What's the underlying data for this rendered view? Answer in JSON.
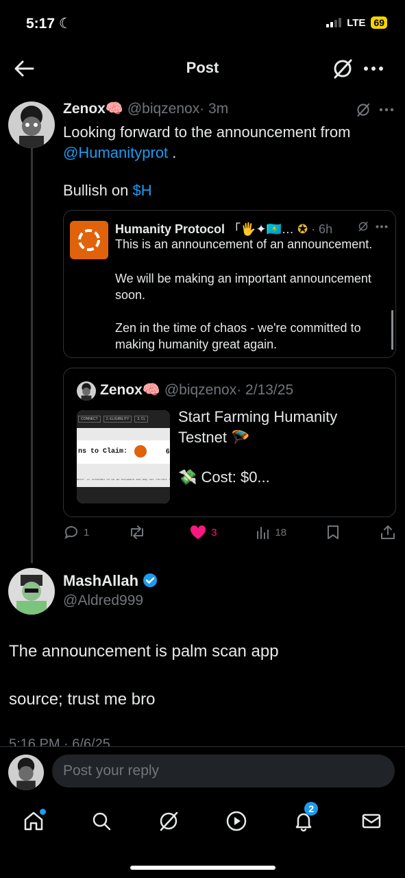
{
  "status": {
    "time": "5:17",
    "network": "LTE",
    "battery": "69"
  },
  "header": {
    "title": "Post"
  },
  "tweet": {
    "name": "Zenox🧠",
    "handle": "@biqzenox",
    "time": "· 3m",
    "text_line1": "Looking forward to the announcement from",
    "mention": "@Humanityprot",
    "after_mention": " .",
    "bullish": "Bullish on ",
    "cashtag": "$H",
    "quote": {
      "name": "Humanity Protocol",
      "emojis": "「🖐✦🇰🇿…",
      "time": "· 6h",
      "line1": "This is an announcement of an announcement.",
      "para2": "We will be making an important announcement soon.",
      "para3": "Zen in the time of chaos - we're committed to making humanity great again."
    },
    "quote2": {
      "name": "Zenox🧠",
      "handle": "@biqzenox",
      "date": "· 2/13/25",
      "text1": "Start Farming  Humanity Testnet 🪂",
      "text2": "💸 Cost: $0...",
      "thumb_tabs": [
        "CONNECT",
        "2. ELIGIBILITY",
        "3. CL"
      ],
      "thumb_label": "ns to Claim:",
      "thumb_value": "6",
      "thumb_note": "Note: It intended to be an estimate and may not reflect final data"
    },
    "counts": {
      "replies": "1",
      "reposts": "",
      "likes": "3",
      "views": "18"
    }
  },
  "reply": {
    "name": "MashAllah",
    "handle": "@Aldred999",
    "text1": "The announcement is palm scan app",
    "text2": "source; trust me bro",
    "timestamp": "5:16 PM · 6/6/25"
  },
  "composer": {
    "placeholder": "Post your reply"
  },
  "tabbar": {
    "notif_badge": "2"
  },
  "colors": {
    "like": "#f91880",
    "link": "#1d9bf0",
    "verified": "#1d9bf0"
  }
}
